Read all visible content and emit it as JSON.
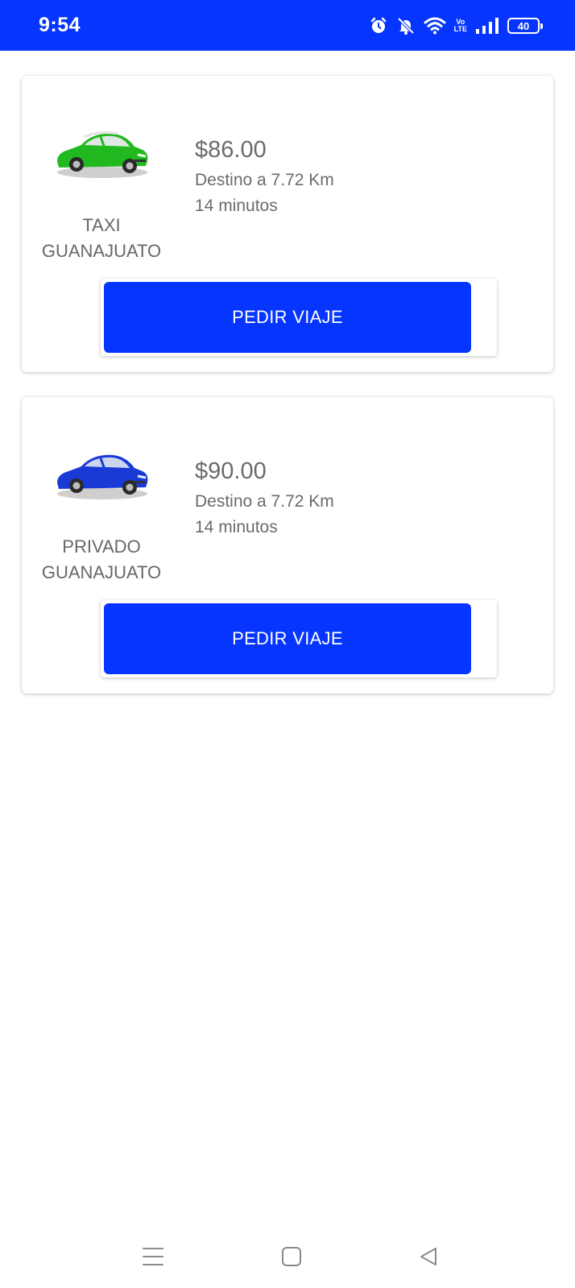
{
  "status_bar": {
    "time": "9:54",
    "battery": "40",
    "volte": [
      "Vo",
      "LTE"
    ],
    "icons": [
      "alarm-icon",
      "bell-off-icon",
      "wifi-icon",
      "volte-icon",
      "signal-icon",
      "battery-icon"
    ],
    "background": "#0535ff"
  },
  "rides": [
    {
      "name_line1": "TAXI",
      "name_line2": "GUANAJUATO",
      "price": "$86.00",
      "distance": "Destino a 7.72 Km",
      "duration": "14 minutos",
      "button_label": "PEDIR VIAJE",
      "car_color": "#22b81f"
    },
    {
      "name_line1": "PRIVADO",
      "name_line2": "GUANAJUATO",
      "price": "$90.00",
      "distance": "Destino a 7.72 Km",
      "duration": "14 minutos",
      "button_label": "PEDIR VIAJE",
      "car_color": "#1a3ad6"
    }
  ],
  "nav_bar": {
    "icons": [
      "menu-icon",
      "home-icon",
      "back-icon"
    ]
  },
  "colors": {
    "accent": "#0535ff",
    "text_gray": "#6b6b6b"
  }
}
